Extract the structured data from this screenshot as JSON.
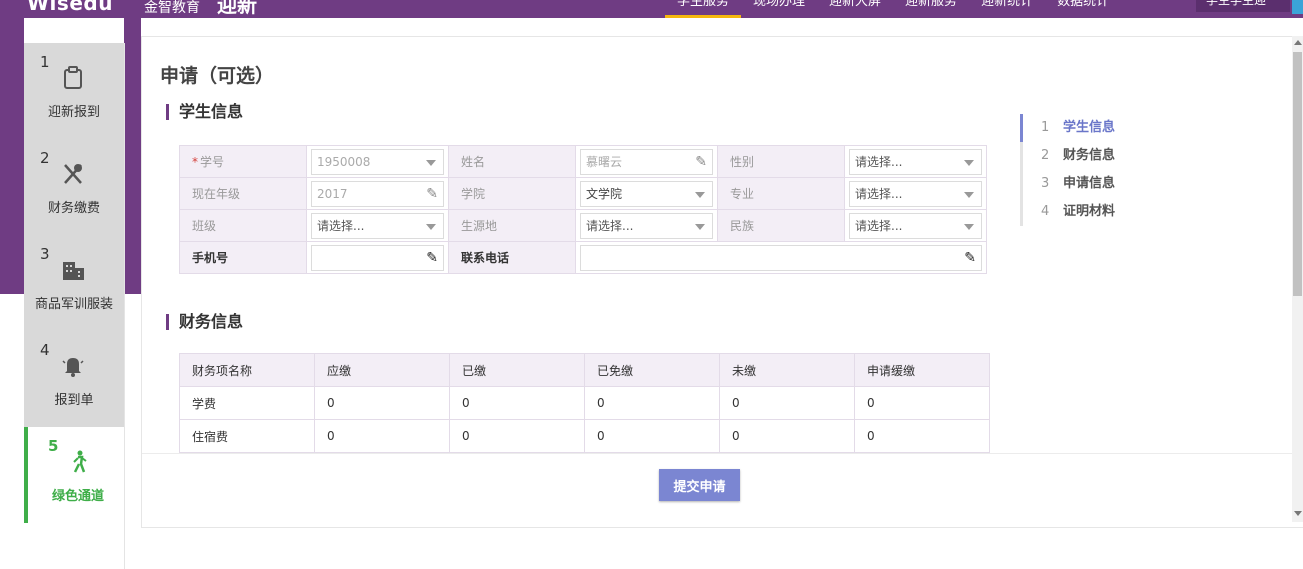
{
  "header": {
    "brand": "Wisedu",
    "brand_sub": "金智教育",
    "app_name": "迎新",
    "nav": [
      "学生服务",
      "现场办理",
      "迎新大屏",
      "迎新服务",
      "迎新统计",
      "数据统计"
    ],
    "active_nav": "学生服务",
    "user": "学生学生迎"
  },
  "steps": [
    {
      "num": "1",
      "label": "迎新报到",
      "icon": "clipboard-icon"
    },
    {
      "num": "2",
      "label": "财务缴费",
      "icon": "utensils-icon"
    },
    {
      "num": "3",
      "label": "商品军训服装",
      "icon": "building-icon"
    },
    {
      "num": "4",
      "label": "报到单",
      "icon": "bell-icon"
    },
    {
      "num": "5",
      "label": "绿色通道",
      "icon": "walking-icon",
      "active": true
    }
  ],
  "main": {
    "page_title": "申请（可选）",
    "student_section_title": "学生信息",
    "finance_section_title": "财务信息",
    "student_form": {
      "student_id": {
        "label": "学号",
        "required": "*",
        "value": "1950008"
      },
      "name": {
        "label": "姓名",
        "value": "慕曙云"
      },
      "gender": {
        "label": "性别",
        "placeholder": "请选择..."
      },
      "grade": {
        "label": "现在年级",
        "value": "2017"
      },
      "college": {
        "label": "学院",
        "value": "文学院"
      },
      "major": {
        "label": "专业",
        "placeholder": "请选择..."
      },
      "class": {
        "label": "班级",
        "placeholder": "请选择..."
      },
      "origin": {
        "label": "生源地",
        "placeholder": "请选择..."
      },
      "ethnicity": {
        "label": "民族",
        "placeholder": "请选择..."
      },
      "mobile": {
        "label": "手机号",
        "value": ""
      },
      "contact_phone": {
        "label": "联系电话",
        "value": ""
      }
    },
    "finance_table": {
      "headers": [
        "财务项名称",
        "应缴",
        "已缴",
        "已免缴",
        "未缴",
        "申请缓缴"
      ],
      "rows": [
        [
          "学费",
          "0",
          "0",
          "0",
          "0",
          "0"
        ],
        [
          "住宿费",
          "0",
          "0",
          "0",
          "0",
          "0"
        ]
      ]
    },
    "submit_label": "提交申请"
  },
  "toc": [
    {
      "num": "1",
      "label": "学生信息",
      "active": true
    },
    {
      "num": "2",
      "label": "财务信息"
    },
    {
      "num": "3",
      "label": "申请信息"
    },
    {
      "num": "4",
      "label": "证明材料"
    }
  ],
  "colors": {
    "brand_purple": "#6f3c83",
    "active_green": "#3fae49",
    "accent_blue": "#7b86d2",
    "nav_underline": "#f5b70e"
  }
}
